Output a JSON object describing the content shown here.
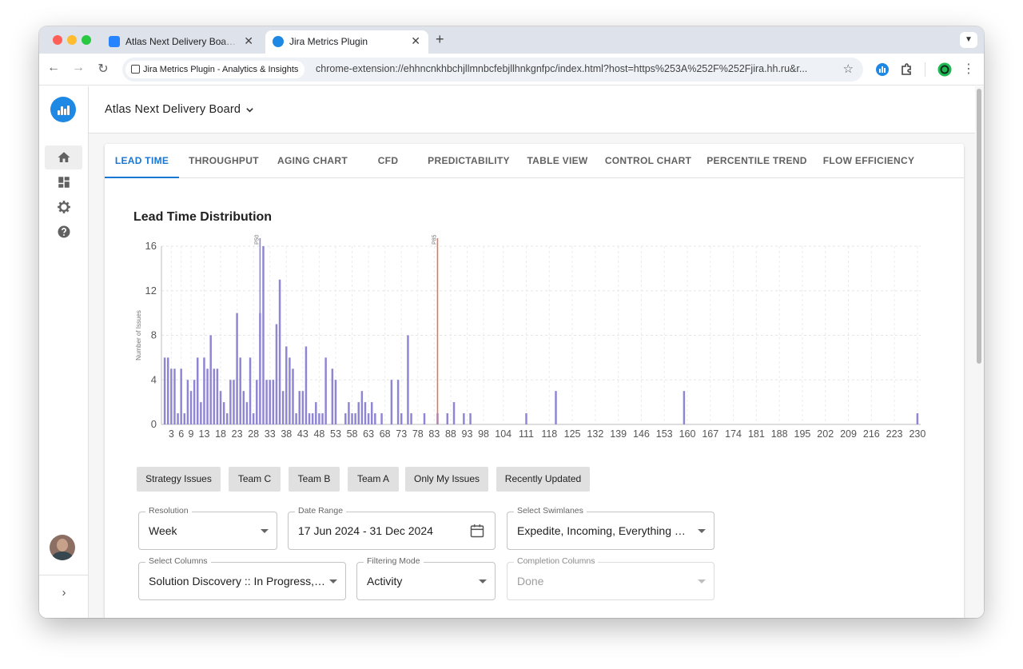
{
  "browser": {
    "tabs": [
      {
        "title": "Atlas Next Delivery Board - Ka",
        "active": false
      },
      {
        "title": "Jira Metrics Plugin",
        "active": true
      }
    ],
    "site_chip": "Jira Metrics Plugin - Analytics & Insights",
    "url": "chrome-extension://ehhncnkhbchjllmnbcfebjllhnkgnfpc/index.html?host=https%253A%252F%252Fjira.hh.ru&r...",
    "icons": [
      "back-icon",
      "forward-icon",
      "reload-icon",
      "star-icon",
      "extension-icon",
      "puzzle-icon",
      "profile-icon",
      "kebab-menu-icon"
    ]
  },
  "sidebar": {
    "items": [
      {
        "icon": "home-icon",
        "active": true
      },
      {
        "icon": "dashboard-icon",
        "active": false
      },
      {
        "icon": "settings-icon",
        "active": false
      },
      {
        "icon": "help-icon",
        "active": false
      }
    ],
    "expand_glyph": "›"
  },
  "header": {
    "board_name": "Atlas Next Delivery Board"
  },
  "tabs": [
    {
      "label": "LEAD TIME",
      "active": true
    },
    {
      "label": "THROUGHPUT"
    },
    {
      "label": "AGING CHART"
    },
    {
      "label": "CFD"
    },
    {
      "label": "PREDICTABILITY"
    },
    {
      "label": "TABLE VIEW"
    },
    {
      "label": "CONTROL CHART"
    },
    {
      "label": "PERCENTILE TREND"
    },
    {
      "label": "FLOW EFFICIENCY"
    }
  ],
  "chart_title": "Lead Time Distribution",
  "chart_data": {
    "type": "bar",
    "title": "Lead Time Distribution",
    "xlabel": "",
    "ylabel": "Number of Issues",
    "ylim": [
      0,
      16
    ],
    "yticks": [
      0,
      4,
      8,
      12,
      16
    ],
    "xlim": [
      0,
      231
    ],
    "xticks": [
      3,
      6,
      9,
      13,
      18,
      23,
      28,
      33,
      38,
      43,
      48,
      53,
      58,
      63,
      68,
      73,
      78,
      83,
      88,
      93,
      98,
      104,
      111,
      118,
      125,
      132,
      139,
      146,
      153,
      160,
      167,
      174,
      181,
      188,
      195,
      202,
      209,
      216,
      223,
      230
    ],
    "grid": true,
    "bar_color": "#8e85d3",
    "x": [
      1,
      2,
      3,
      4,
      5,
      6,
      7,
      8,
      9,
      10,
      11,
      12,
      13,
      14,
      15,
      16,
      17,
      18,
      19,
      20,
      21,
      22,
      23,
      24,
      25,
      26,
      27,
      28,
      29,
      30,
      31,
      32,
      33,
      34,
      35,
      36,
      37,
      38,
      39,
      40,
      41,
      42,
      43,
      44,
      45,
      46,
      47,
      48,
      49,
      50,
      52,
      53,
      56,
      57,
      58,
      59,
      60,
      61,
      62,
      63,
      64,
      65,
      67,
      70,
      72,
      73,
      75,
      76,
      80,
      84,
      87,
      89,
      92,
      94,
      111,
      120,
      159,
      230
    ],
    "values": [
      6,
      6,
      5,
      5,
      1,
      5,
      1,
      4,
      3,
      4,
      6,
      2,
      6,
      5,
      8,
      5,
      5,
      3,
      2,
      1,
      4,
      4,
      10,
      6,
      3,
      2,
      6,
      1,
      4,
      10,
      16,
      4,
      4,
      4,
      9,
      13,
      3,
      7,
      6,
      5,
      1,
      3,
      3,
      7,
      1,
      1,
      2,
      1,
      1,
      6,
      5,
      4,
      1,
      2,
      1,
      1,
      2,
      3,
      2,
      1,
      2,
      1,
      1,
      4,
      4,
      1,
      8,
      1,
      1,
      1,
      1,
      2,
      1,
      1,
      1,
      3,
      3,
      1,
      1,
      1
    ],
    "reference_lines": [
      {
        "label": "P50",
        "x": 30,
        "color": "#8e85d3"
      },
      {
        "label": "P85",
        "x": 84,
        "color": "#e07a5f"
      }
    ]
  },
  "filters": {
    "chips": [
      "Strategy Issues",
      "Team C",
      "Team B",
      "Team A",
      "Only My Issues",
      "Recently Updated"
    ],
    "resolution": {
      "label": "Resolution",
      "value": "Week"
    },
    "date_range": {
      "label": "Date Range",
      "value": "17 Jun 2024 - 31 Dec 2024"
    },
    "swimlanes": {
      "label": "Select Swimlanes",
      "value": "Expedite, Incoming, Everything El..."
    },
    "columns": {
      "label": "Select Columns",
      "value": "Solution Discovery :: In Progress, ..."
    },
    "filtering_mode": {
      "label": "Filtering Mode",
      "value": "Activity"
    },
    "completion": {
      "label": "Completion Columns",
      "value": "Done",
      "disabled": true
    }
  }
}
